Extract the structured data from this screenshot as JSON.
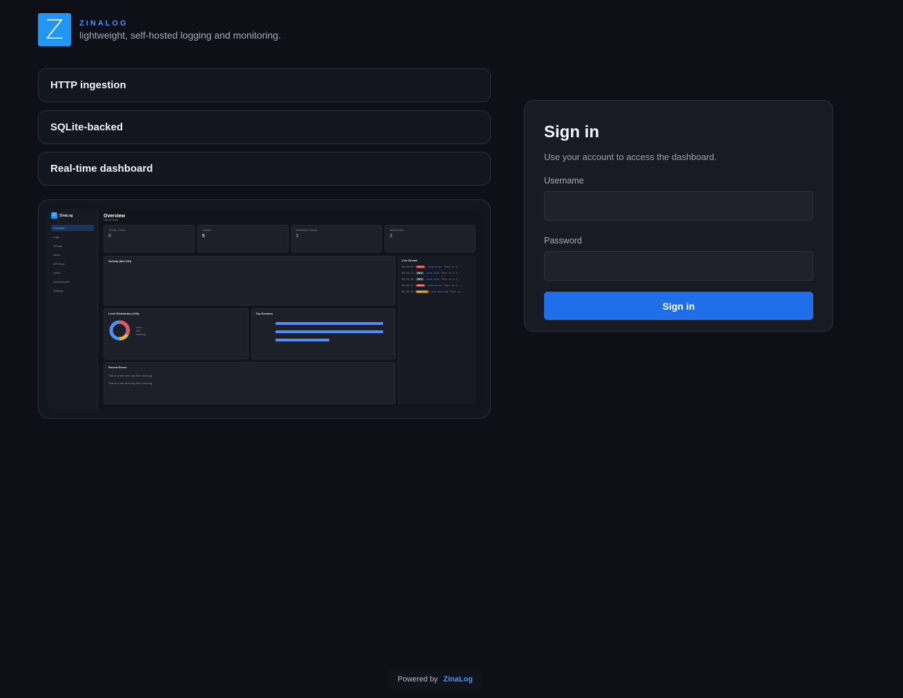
{
  "brand": {
    "logo_letter": "Z",
    "name": "ZINALOG",
    "tagline": "lightweight, self-hosted logging and monitoring."
  },
  "features": [
    "HTTP ingestion",
    "SQLite-backed",
    "Real-time dashboard"
  ],
  "preview": {
    "app_name": "ZinaLog",
    "nav": [
      "Overview",
      "Logs",
      "Groups",
      "Alerts",
      "API Keys",
      "Users",
      "Access Audit",
      "Settings"
    ],
    "title": "Overview",
    "subtitle": "Last 24 hours",
    "stats": [
      {
        "label": "TOTAL LOGS",
        "value": "5"
      },
      {
        "label": "TODAY",
        "value": "5"
      },
      {
        "label": "ERRORS TODAY",
        "value": "2"
      },
      {
        "label": "SERVICES",
        "value": "3"
      }
    ],
    "activity_title": "Activity (last 24h)",
    "level_title": "Level Distribution (24h)",
    "levels": [
      "error",
      "info",
      "warning"
    ],
    "top_services_title": "Top Services",
    "recent_errors_title": "Recent Errors",
    "error_line": "This is a test error log from ZinaLog",
    "live_title": "Live Stream",
    "live_lines": [
      {
        "time": "09:54:09",
        "level": "ERROR",
        "svc": "zina-error",
        "msg": "This is a ..."
      },
      {
        "time": "09:54:14",
        "level": "INFO",
        "svc": "zina-info",
        "msg": "This is a t..."
      },
      {
        "time": "09:54:30",
        "level": "INFO",
        "svc": "zina-info",
        "msg": "This is a t..."
      },
      {
        "time": "09:54:37",
        "level": "ERROR",
        "svc": "zina-error",
        "msg": "This is a ..."
      },
      {
        "time": "09:54:45",
        "level": "WARNING",
        "svc": "zina-warning",
        "msg": "This is..."
      }
    ]
  },
  "login": {
    "title": "Sign in",
    "subtitle": "Use your account to access the dashboard.",
    "username_label": "Username",
    "username_value": "",
    "password_label": "Password",
    "password_value": "",
    "button": "Sign in"
  },
  "footer": {
    "prefix": "Powered by",
    "link": "ZinaLog"
  },
  "colors": {
    "background": "#0e0f17",
    "accent": "#1f6feb",
    "brand_blue": "#2196f3"
  }
}
